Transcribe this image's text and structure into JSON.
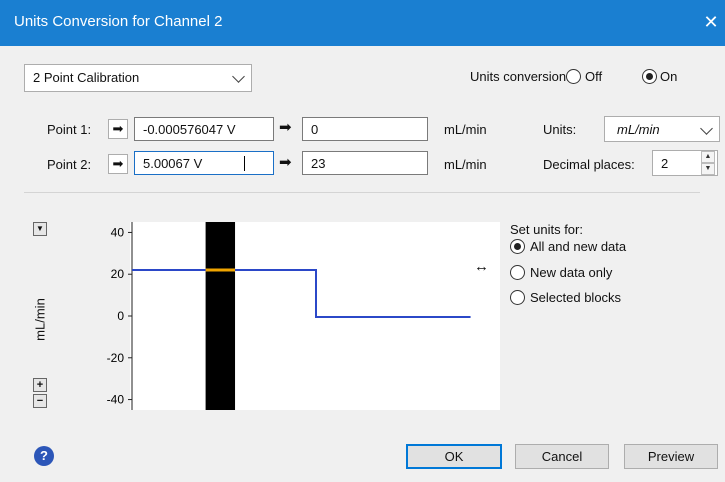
{
  "window": {
    "title": "Units Conversion for Channel 2",
    "close_glyph": "✕"
  },
  "calibration_mode": {
    "selected": "2 Point Calibration"
  },
  "units_conversion": {
    "label": "Units conversion:",
    "off_label": "Off",
    "on_label": "On",
    "selected": "On"
  },
  "point1": {
    "label": "Point 1:",
    "input_value": "-0.000576047 V",
    "output_value": "0",
    "unit": "mL/min"
  },
  "point2": {
    "label": "Point 2:",
    "input_value": "5.00067 V",
    "output_value": "23",
    "unit": "mL/min"
  },
  "units": {
    "label": "Units:",
    "selected": "mL/min"
  },
  "decimal_places": {
    "label": "Decimal places:",
    "value": "2"
  },
  "set_units": {
    "label": "Set units for:",
    "options": [
      "All and new data",
      "New data only",
      "Selected blocks"
    ],
    "selected": "All and new data"
  },
  "chart_data": {
    "type": "line",
    "ylabel": "mL/min",
    "yticks": [
      "40",
      "20",
      "0",
      "-20",
      "-40"
    ],
    "ylim": [
      -45,
      45
    ],
    "series": [
      {
        "values_segments": [
          {
            "x": [
              0,
              0.5
            ],
            "y": 22
          },
          {
            "x": [
              0.5,
              0.92
            ],
            "y": -0.5
          }
        ]
      }
    ],
    "selection": {
      "x": [
        0.2,
        0.28
      ],
      "color": "#000000"
    },
    "colors": {
      "line": "#2b48c8",
      "highlight": "#f0a500"
    }
  },
  "buttons": {
    "ok": "OK",
    "cancel": "Cancel",
    "preview": "Preview",
    "zoom_in": "+",
    "zoom_out": "−"
  },
  "icons": {
    "help": "?",
    "arrow": "➡"
  }
}
